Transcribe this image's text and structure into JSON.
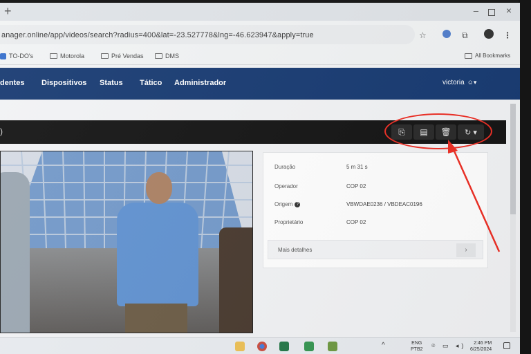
{
  "browser": {
    "new_tab_symbol": "+",
    "window_controls": {
      "minimize": "–",
      "close": "×"
    },
    "url": "anager.online/app/videos/search?radius=400&lat=-23.527778&lng=-46.623947&apply=true",
    "icons": [
      "star-icon",
      "extension-icon",
      "puzzle-icon",
      "profile-icon",
      "menu-dots-icon"
    ],
    "star_symbol": "☆",
    "puzzle_symbol": "⧉",
    "menu_symbol": "⋮"
  },
  "bookmarks": {
    "items": [
      {
        "label": "TO-DO's"
      },
      {
        "label": "Motorola"
      },
      {
        "label": "Pré Vendas"
      },
      {
        "label": "DMS"
      }
    ],
    "all_bookmarks": "All Bookmarks"
  },
  "navbar": {
    "items": [
      {
        "label": "dentes"
      },
      {
        "label": "Dispositivos"
      },
      {
        "label": "Status"
      },
      {
        "label": "Tático"
      },
      {
        "label": "Administrador"
      }
    ],
    "user": "victoria",
    "user_icon": "▴"
  },
  "video_header": {
    "left_mark": ")",
    "actions": [
      {
        "name": "export-icon",
        "symbol": "⎘"
      },
      {
        "name": "new-document-icon",
        "symbol": "▤"
      },
      {
        "name": "trash-icon",
        "symbol": "🗑"
      },
      {
        "name": "refresh-icon",
        "symbol": "↻ ▾"
      }
    ],
    "annotation_color": "#ff2a1f"
  },
  "details": {
    "rows": [
      {
        "label": "Duração",
        "value": "5 m 31 s"
      },
      {
        "label": "Operador",
        "value": "COP 02"
      },
      {
        "label": "Origem",
        "value": "VBWDAE0236 / VBDEAC0196"
      },
      {
        "label": "Proprietário",
        "value": "COP 02"
      }
    ],
    "help_symbol": "?",
    "more_details": "Mais detalhes",
    "more_chevron": "›"
  },
  "taskbar": {
    "chevron": "^",
    "lang_line1": "ENG",
    "lang_line2": "PTB2",
    "tray_symbols": "⌾ ▭ ◂)",
    "clock_time": "2:46 PM",
    "clock_date": "6/25/2024"
  },
  "colors": {
    "navbar": "#143a78",
    "video_header": "#141414",
    "annotation": "#ff2a1f"
  }
}
